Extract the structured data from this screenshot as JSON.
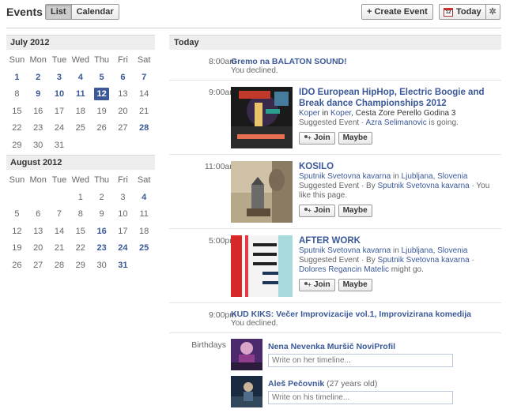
{
  "header": {
    "title": "Events",
    "view_tabs": [
      {
        "label": "List",
        "active": true
      },
      {
        "label": "Calendar",
        "active": false
      }
    ],
    "create_label": "+ Create Event",
    "today_label": "Today",
    "calendar_icon_number": "12",
    "settings_icon": "gear-icon"
  },
  "calendars": [
    {
      "month": "July 2012",
      "dows": [
        "Sun",
        "Mon",
        "Tue",
        "Wed",
        "Thu",
        "Fri",
        "Sat"
      ],
      "weeks": [
        [
          {
            "d": "1",
            "ev": true
          },
          {
            "d": "2",
            "ev": true
          },
          {
            "d": "3",
            "ev": true
          },
          {
            "d": "4",
            "ev": true
          },
          {
            "d": "5",
            "ev": true
          },
          {
            "d": "6",
            "ev": true
          },
          {
            "d": "7",
            "ev": true
          }
        ],
        [
          {
            "d": "8"
          },
          {
            "d": "9",
            "ev": true
          },
          {
            "d": "10",
            "ev": true
          },
          {
            "d": "11",
            "ev": true
          },
          {
            "d": "12",
            "sel": true
          },
          {
            "d": "13"
          },
          {
            "d": "14"
          }
        ],
        [
          {
            "d": "15"
          },
          {
            "d": "16"
          },
          {
            "d": "17"
          },
          {
            "d": "18"
          },
          {
            "d": "19"
          },
          {
            "d": "20"
          },
          {
            "d": "21"
          }
        ],
        [
          {
            "d": "22"
          },
          {
            "d": "23"
          },
          {
            "d": "24"
          },
          {
            "d": "25"
          },
          {
            "d": "26"
          },
          {
            "d": "27"
          },
          {
            "d": "28",
            "ev": true
          }
        ],
        [
          {
            "d": "29"
          },
          {
            "d": "30"
          },
          {
            "d": "31"
          },
          {
            "d": ""
          },
          {
            "d": ""
          },
          {
            "d": ""
          },
          {
            "d": ""
          }
        ]
      ]
    },
    {
      "month": "August 2012",
      "dows": [
        "Sun",
        "Mon",
        "Tue",
        "Wed",
        "Thu",
        "Fri",
        "Sat"
      ],
      "weeks": [
        [
          {
            "d": ""
          },
          {
            "d": ""
          },
          {
            "d": ""
          },
          {
            "d": "1"
          },
          {
            "d": "2"
          },
          {
            "d": "3"
          },
          {
            "d": "4",
            "ev": true
          }
        ],
        [
          {
            "d": "5"
          },
          {
            "d": "6"
          },
          {
            "d": "7"
          },
          {
            "d": "8"
          },
          {
            "d": "9"
          },
          {
            "d": "10"
          },
          {
            "d": "11"
          }
        ],
        [
          {
            "d": "12"
          },
          {
            "d": "13"
          },
          {
            "d": "14"
          },
          {
            "d": "15"
          },
          {
            "d": "16",
            "ev": true
          },
          {
            "d": "17"
          },
          {
            "d": "18"
          }
        ],
        [
          {
            "d": "19"
          },
          {
            "d": "20"
          },
          {
            "d": "21"
          },
          {
            "d": "22"
          },
          {
            "d": "23",
            "ev": true
          },
          {
            "d": "24",
            "ev": true
          },
          {
            "d": "25",
            "ev": true
          }
        ],
        [
          {
            "d": "26"
          },
          {
            "d": "27"
          },
          {
            "d": "28"
          },
          {
            "d": "29"
          },
          {
            "d": "30"
          },
          {
            "d": "31",
            "ev": true
          },
          {
            "d": ""
          }
        ]
      ]
    }
  ],
  "today": {
    "heading": "Today",
    "events": [
      {
        "time": "8:00am",
        "title": "Gremo na BALATON SOUND!",
        "status": "You declined."
      },
      {
        "time": "9:00am",
        "title": "IDO European HipHop, Electric Boogie and Break dance Championships 2012",
        "place_link": "Koper",
        "place_in": " in ",
        "place_link2": "Koper",
        "place_rest": ", Cesta Zore Perello Godina 3",
        "suggest_prefix": "Suggested Event · ",
        "suggest_person": "Azra Selimanovic",
        "suggest_suffix": " is going.",
        "join_label": "Join",
        "maybe_label": "Maybe"
      },
      {
        "time": "11:00am",
        "title": "KOSILO",
        "place_link": "Sputnik Svetovna kavarna",
        "place_in": " in ",
        "place_link2": "Ljubljana, Slovenia",
        "suggest_prefix": "Suggested Event · By ",
        "suggest_person": "Sputnik Svetovna kavarna",
        "suggest_suffix": " · You like this page.",
        "join_label": "Join",
        "maybe_label": "Maybe"
      },
      {
        "time": "5:00pm",
        "title": "AFTER WORK",
        "place_link": "Sputnik Svetovna kavarna",
        "place_in": " in ",
        "place_link2": "Ljubljana, Slovenia",
        "suggest_prefix": "Suggested Event · By ",
        "suggest_person": "Sputnik Svetovna kavarna",
        "suggest_mid": " · ",
        "suggest_person2": "Dolores Regancin Matelic",
        "suggest_suffix": " might go.",
        "join_label": "Join",
        "maybe_label": "Maybe"
      },
      {
        "time": "9:00pm",
        "title": "KUD KIKS: Večer Improvizacije vol.1, Improvizirana komedija",
        "status": "You declined."
      }
    ],
    "birthdays_label": "Birthdays",
    "birthdays": [
      {
        "name": "Nena Nevenka Muršič NoviProfil",
        "extra": "",
        "placeholder": "Write on her timeline..."
      },
      {
        "name": "Aleš Pečovnik",
        "extra": " (27 years old)",
        "placeholder": "Write on his timeline..."
      }
    ]
  },
  "colors": {
    "link": "#3b5998",
    "header_bg": "#eeeeee",
    "selected_day_bg": "#3b5998"
  }
}
